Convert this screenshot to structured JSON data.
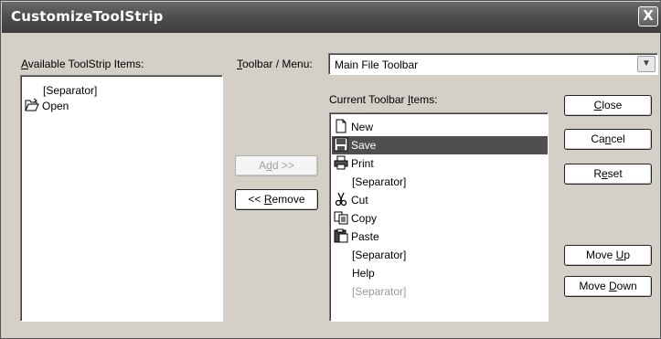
{
  "window": {
    "title": "CustomizeToolStrip",
    "close_glyph": "X"
  },
  "available": {
    "label_prefix": "",
    "label_accel": "A",
    "label_rest": "vailable ToolStrip Items:",
    "items": [
      {
        "label": "[Separator]",
        "icon": ""
      },
      {
        "label": "Open",
        "icon": "open-folder-icon"
      }
    ]
  },
  "toolbar_menu": {
    "label_accel": "T",
    "label_rest": "oolbar / Menu:",
    "selected": "Main File Toolbar"
  },
  "current": {
    "label_prefix": "Current Toolbar ",
    "label_accel": "I",
    "label_rest": "tems:",
    "items": [
      {
        "label": "New",
        "icon": "new-document-icon",
        "state": "normal"
      },
      {
        "label": "Save",
        "icon": "save-disk-icon",
        "state": "selected"
      },
      {
        "label": "Print",
        "icon": "printer-icon",
        "state": "normal"
      },
      {
        "label": "[Separator]",
        "icon": "",
        "state": "normal"
      },
      {
        "label": "Cut",
        "icon": "scissors-icon",
        "state": "normal"
      },
      {
        "label": "Copy",
        "icon": "copy-icon",
        "state": "normal"
      },
      {
        "label": "Paste",
        "icon": "paste-icon",
        "state": "normal"
      },
      {
        "label": "[Separator]",
        "icon": "",
        "state": "normal"
      },
      {
        "label": "Help",
        "icon": "",
        "state": "normal"
      },
      {
        "label": "[Separator]",
        "icon": "",
        "state": "disabled"
      }
    ]
  },
  "buttons": {
    "add": {
      "pre": "A",
      "accel": "d",
      "post": "d >>"
    },
    "remove": {
      "pre": "<< ",
      "accel": "R",
      "post": "emove"
    },
    "close": {
      "pre": "",
      "accel": "C",
      "post": "lose"
    },
    "cancel": {
      "pre": "Ca",
      "accel": "n",
      "post": "cel"
    },
    "reset": {
      "pre": "R",
      "accel": "e",
      "post": "set"
    },
    "move_up": {
      "pre": "Move ",
      "accel": "U",
      "post": "p"
    },
    "move_down": {
      "pre": "Move ",
      "accel": "D",
      "post": "own"
    }
  }
}
